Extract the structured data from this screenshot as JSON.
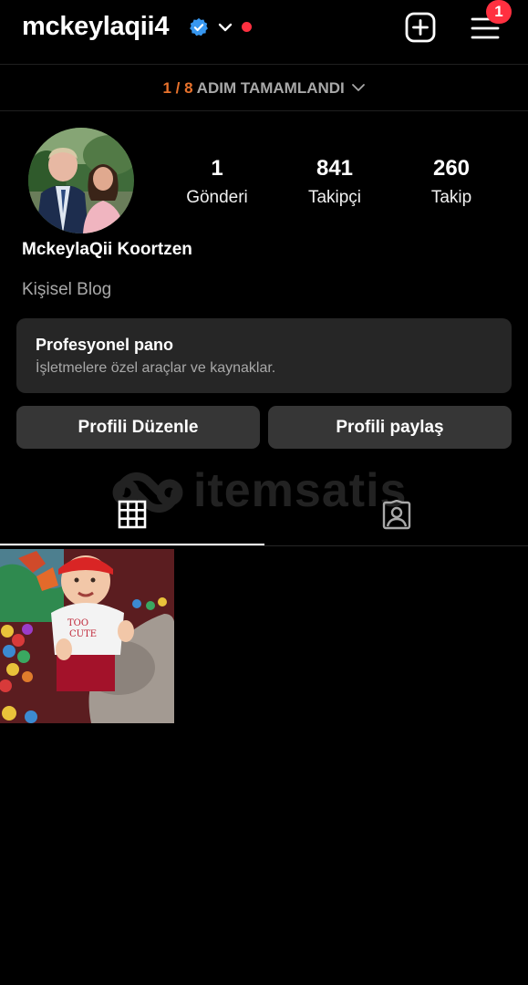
{
  "header": {
    "username": "mckeylaqii4",
    "notification_count": "1",
    "icons": [
      "verified-badge-icon",
      "chevron-down-icon",
      "new-post-plus-icon",
      "hamburger-menu-icon"
    ]
  },
  "steps_banner": {
    "count": "1 / 8",
    "label": "ADIM TAMAMLANDI"
  },
  "profile": {
    "stats": [
      {
        "value": "1",
        "label": "Gönderi"
      },
      {
        "value": "841",
        "label": "Takipçi"
      },
      {
        "value": "260",
        "label": "Takip"
      }
    ],
    "full_name": "MckeylaQii Koortzen",
    "category": "Kişisel Blog"
  },
  "professional_dashboard": {
    "title": "Profesyonel pano",
    "subtitle": "İşletmelere özel araçlar ve kaynaklar."
  },
  "actions": {
    "edit_profile": "Profili Düzenle",
    "share_profile": "Profili paylaş"
  },
  "watermark": {
    "text": "itemsatis"
  },
  "tabs": [
    {
      "name": "grid",
      "icon": "grid-icon",
      "active": true
    },
    {
      "name": "tagged",
      "icon": "tagged-person-icon",
      "active": false
    }
  ],
  "colors": {
    "accent_orange": "#e8722c",
    "notification_red": "#ff3040",
    "verified_blue": "#3797f0",
    "button_bg": "#363636",
    "card_bg": "#262626"
  }
}
